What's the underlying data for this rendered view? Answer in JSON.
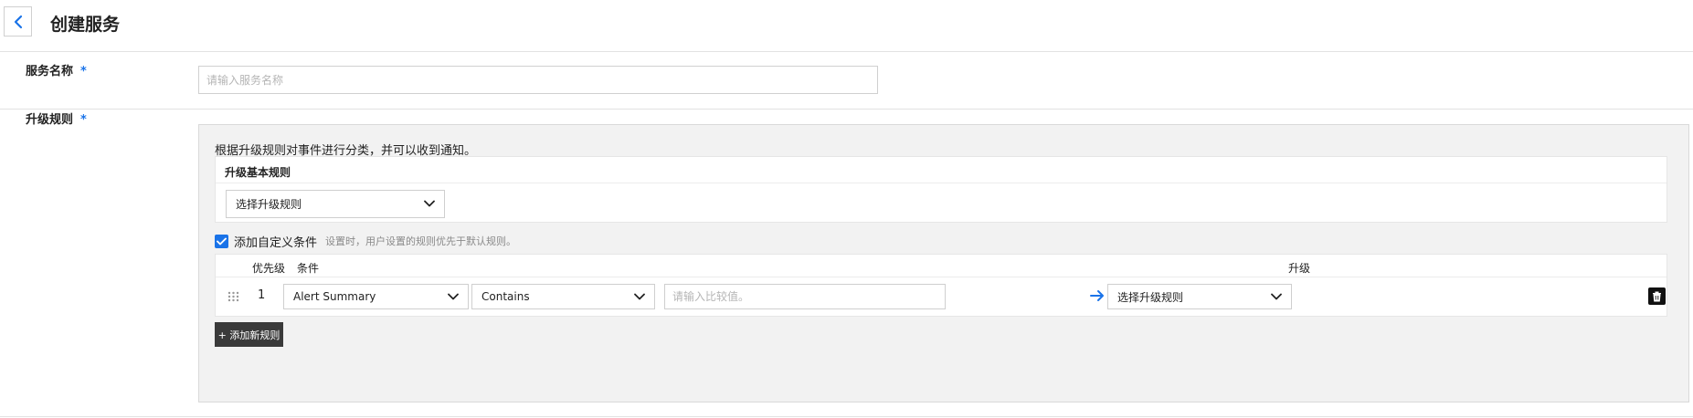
{
  "header": {
    "title": "创建服务"
  },
  "service_name": {
    "label": "服务名称",
    "required_mark": "*",
    "placeholder": "请输入服务名称",
    "value": ""
  },
  "escalation": {
    "label": "升级规则",
    "required_mark": "*",
    "description": "根据升级规则对事件进行分类，并可以收到通知。",
    "basic_rule": {
      "title": "升级基本规则",
      "select_value": "选择升级规则"
    },
    "custom_condition": {
      "checked": true,
      "label": "添加自定义条件",
      "hint": "设置时，用户设置的规则优先于默认规则。"
    },
    "table": {
      "headers": {
        "priority": "优先级",
        "condition": "条件",
        "escalate": "升级"
      },
      "rows": [
        {
          "priority": "1",
          "field": "Alert Summary",
          "operator": "Contains",
          "value_placeholder": "请输入比较值。",
          "value": "",
          "escalate": "选择升级规则"
        }
      ]
    },
    "add_button": "+ 添加新规则"
  },
  "colors": {
    "accent": "#1a73e8",
    "button_dark": "#3a3a3a",
    "panel_bg": "#f2f2f2"
  },
  "icons": {
    "back": "chevron-left-icon",
    "dropdown": "chevron-down-icon",
    "check": "check-icon",
    "drag": "drag-handle-icon",
    "arrow": "arrow-right-icon",
    "delete": "trash-icon"
  }
}
